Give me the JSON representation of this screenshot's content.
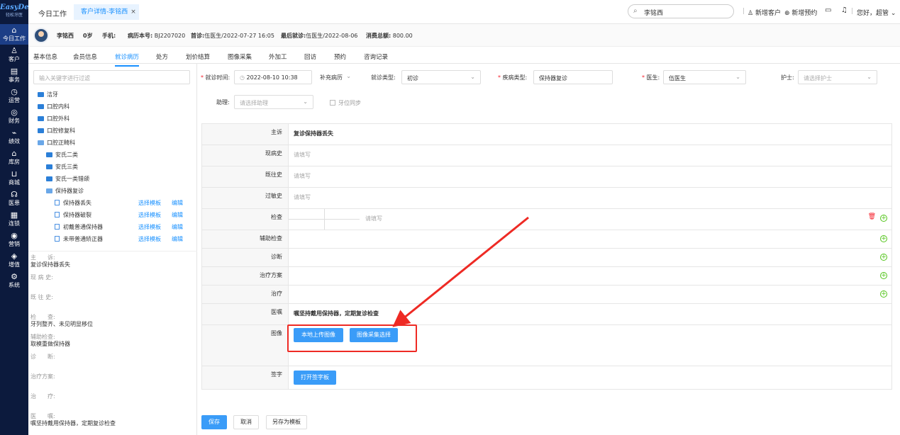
{
  "sidebar": {
    "logo": "EasyDent",
    "logo_sub": "轻松牙医",
    "items": [
      {
        "label": "今日工作",
        "icon": "home-icon"
      },
      {
        "label": "客户",
        "icon": "user-icon"
      },
      {
        "label": "事务",
        "icon": "calendar-icon"
      },
      {
        "label": "运营",
        "icon": "clock-icon"
      },
      {
        "label": "财务",
        "icon": "finance-icon"
      },
      {
        "label": "绩效",
        "icon": "chart-icon"
      },
      {
        "label": "库房",
        "icon": "warehouse-icon"
      },
      {
        "label": "商城",
        "icon": "cart-icon"
      },
      {
        "label": "医患",
        "icon": "doctor-icon"
      },
      {
        "label": "连锁",
        "icon": "chain-icon"
      },
      {
        "label": "营销",
        "icon": "marketing-icon"
      },
      {
        "label": "增值",
        "icon": "bag-icon"
      },
      {
        "label": "系统",
        "icon": "gear-icon"
      }
    ]
  },
  "top": {
    "tab_today": "今日工作",
    "tab_active": "客户详情-李铭西",
    "tab_close": "×",
    "search_value": "李铭西",
    "new_customer": "新增客户",
    "new_appointment": "新增预约",
    "greeting": "您好，超管"
  },
  "patient": {
    "name": "李铭西",
    "age": "0岁",
    "phone_label": "手机:",
    "record_label": "病历本号:",
    "record_no": "BJ2207020",
    "first_label": "首诊:",
    "first_visit": "伍医生/2022-07-27 16:05",
    "last_label": "最后就诊:",
    "last_visit": "伍医生/2022-08-06",
    "total_label": "消费总额:",
    "total": "800.00"
  },
  "subtabs": [
    "基本信息",
    "会员信息",
    "就诊病历",
    "处方",
    "划价结算",
    "图像采集",
    "外加工",
    "回访",
    "预约",
    "咨询记录"
  ],
  "tree": {
    "filter_placeholder": "输入关键字进行过滤",
    "folders": [
      "洁牙",
      "口腔内科",
      "口腔外科",
      "口腔修复科",
      "口腔正畸科"
    ],
    "sub_folders": [
      "安氏二类",
      "安氏三类",
      "安氏一类错颌",
      "保持器复诊"
    ],
    "templates": [
      "保持器丢失",
      "保持器破裂",
      "初戴普通保持器",
      "未带普通矫正器"
    ],
    "select_label": "选择模板",
    "edit_label": "编辑"
  },
  "preview": {
    "chief_label": "主　　诉:",
    "chief_value": "复诊保持器丢失",
    "present_label": "现 病 史:",
    "past_label": "既 往 史:",
    "exam_label": "检　　查:",
    "exam_value": "牙列整齐、未见明显移位",
    "aux_label": "辅助检查:",
    "aux_value": "取模重做保持器",
    "diag_label": "诊　　断:",
    "plan_label": "治疗方案:",
    "treat_label": "治　　疗:",
    "advice_label": "医　　嘱:",
    "advice_value": "嘱坚持戴用保持器，定期复诊检查"
  },
  "form": {
    "visit_time_label": "就诊时间:",
    "visit_time": "2022-08-10 10:38",
    "supplement_label": "补充病历",
    "visit_type_label": "就诊类型:",
    "visit_type": "初诊",
    "disease_type_label": "疾病类型:",
    "disease_type": "保持器复诊",
    "doctor_label": "医生:",
    "doctor": "伍医生",
    "nurse_label": "护士:",
    "nurse_placeholder": "请选择护士",
    "assistant_label": "助理:",
    "assistant_placeholder": "请选择助理",
    "tooth_sync": "牙位同步"
  },
  "record": {
    "chief_label": "主诉",
    "chief_value": "复诊保持器丢失",
    "present_label": "现病史",
    "past_label": "既往史",
    "allergy_label": "过敏史",
    "exam_label": "检查",
    "aux_label": "辅助检查",
    "diag_label": "诊断",
    "plan_label": "治疗方案",
    "treat_label": "治疗",
    "advice_label": "医嘱",
    "advice_value": "嘱坚持戴用保持器，定期复诊检查",
    "image_label": "图像",
    "sign_label": "签字",
    "placeholder": "请填写",
    "upload_local": "本地上传图像",
    "select_image": "图像采集选择",
    "open_sign": "打开签字板"
  },
  "actions": {
    "save": "保存",
    "cancel": "取消",
    "save_template": "另存为模板"
  }
}
